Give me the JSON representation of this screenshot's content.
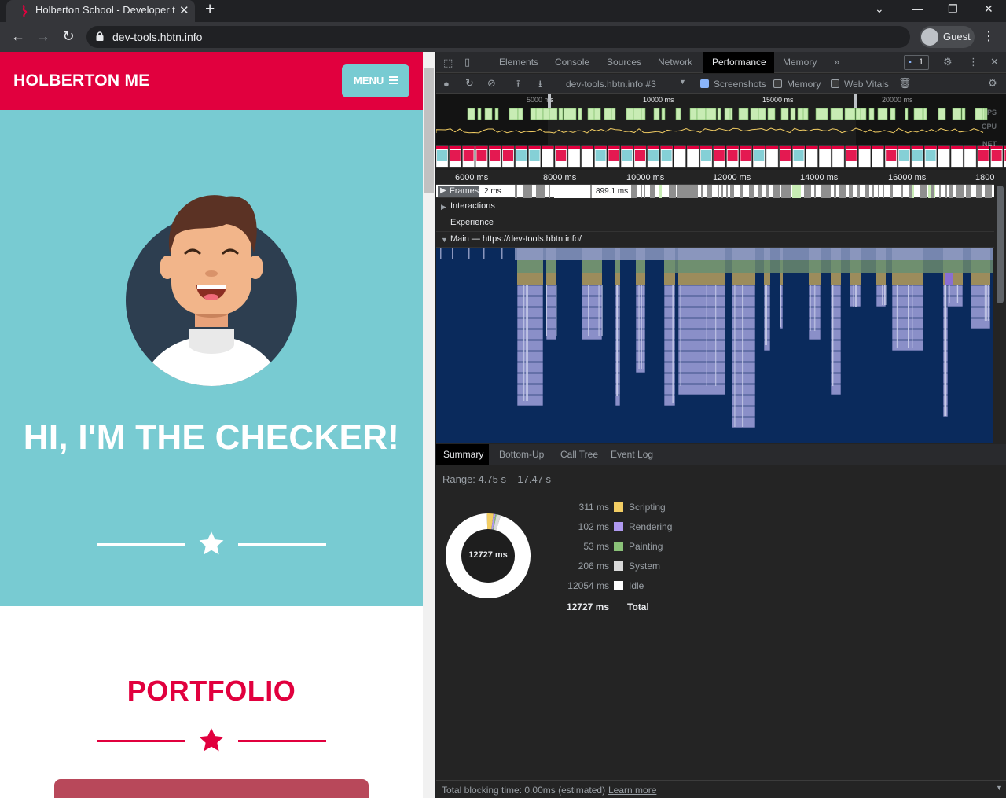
{
  "browser": {
    "tab_title": "Holberton School - Developer to",
    "url": "dev-tools.hbtn.info",
    "profile_label": "Guest",
    "new_tab_glyph": "+",
    "close_glyph": "✕"
  },
  "site": {
    "brand": "HOLBERTON ME",
    "menu_label": "MENU",
    "hero_title": "HI, I'M THE CHECKER!",
    "section_title": "PORTFOLIO",
    "colors": {
      "brand_red": "#e1003e",
      "hero_teal": "#78cbd2",
      "card": "#b8485a"
    }
  },
  "devtools": {
    "tabs": [
      "Elements",
      "Console",
      "Sources",
      "Network",
      "Performance",
      "Memory"
    ],
    "active_tab": "Performance",
    "issues_count": "1",
    "recording_select": "dev-tools.hbtn.info #3",
    "checkboxes": [
      {
        "label": "Screenshots",
        "checked": true
      },
      {
        "label": "Memory",
        "checked": false
      },
      {
        "label": "Web Vitals",
        "checked": false
      }
    ],
    "overview_ticks": [
      "5000 ms",
      "10000 ms",
      "15000 ms",
      "20000 ms"
    ],
    "overview_labels": [
      "FPS",
      "CPU",
      "NET"
    ],
    "ruler_ticks": [
      "6000 ms",
      "8000 ms",
      "10000 ms",
      "12000 ms",
      "14000 ms",
      "16000 ms",
      "1800"
    ],
    "tracks": {
      "frames": "Frames",
      "frames_value_a": "2 ms",
      "frames_value_b": "899.1 ms",
      "interactions": "Interactions",
      "experience": "Experience",
      "main": "Main — https://dev-tools.hbtn.info/"
    },
    "bottom_tabs": [
      "Summary",
      "Bottom-Up",
      "Call Tree",
      "Event Log"
    ],
    "active_bottom_tab": "Summary",
    "summary": {
      "range": "Range: 4.75 s – 17.47 s",
      "total_center": "12727 ms",
      "items": [
        {
          "value": "311 ms",
          "label": "Scripting",
          "color": "#f2cd63",
          "ms": 311
        },
        {
          "value": "102 ms",
          "label": "Rendering",
          "color": "#af99ef",
          "ms": 102
        },
        {
          "value": "53 ms",
          "label": "Painting",
          "color": "#8ac178",
          "ms": 53
        },
        {
          "value": "206 ms",
          "label": "System",
          "color": "#d9d9d9",
          "ms": 206
        },
        {
          "value": "12054 ms",
          "label": "Idle",
          "color": "#ffffff",
          "ms": 12054
        }
      ],
      "total_value": "12727 ms",
      "total_label": "Total"
    },
    "footer_text": "Total blocking time: 0.00ms (estimated)",
    "footer_link": "Learn more"
  }
}
